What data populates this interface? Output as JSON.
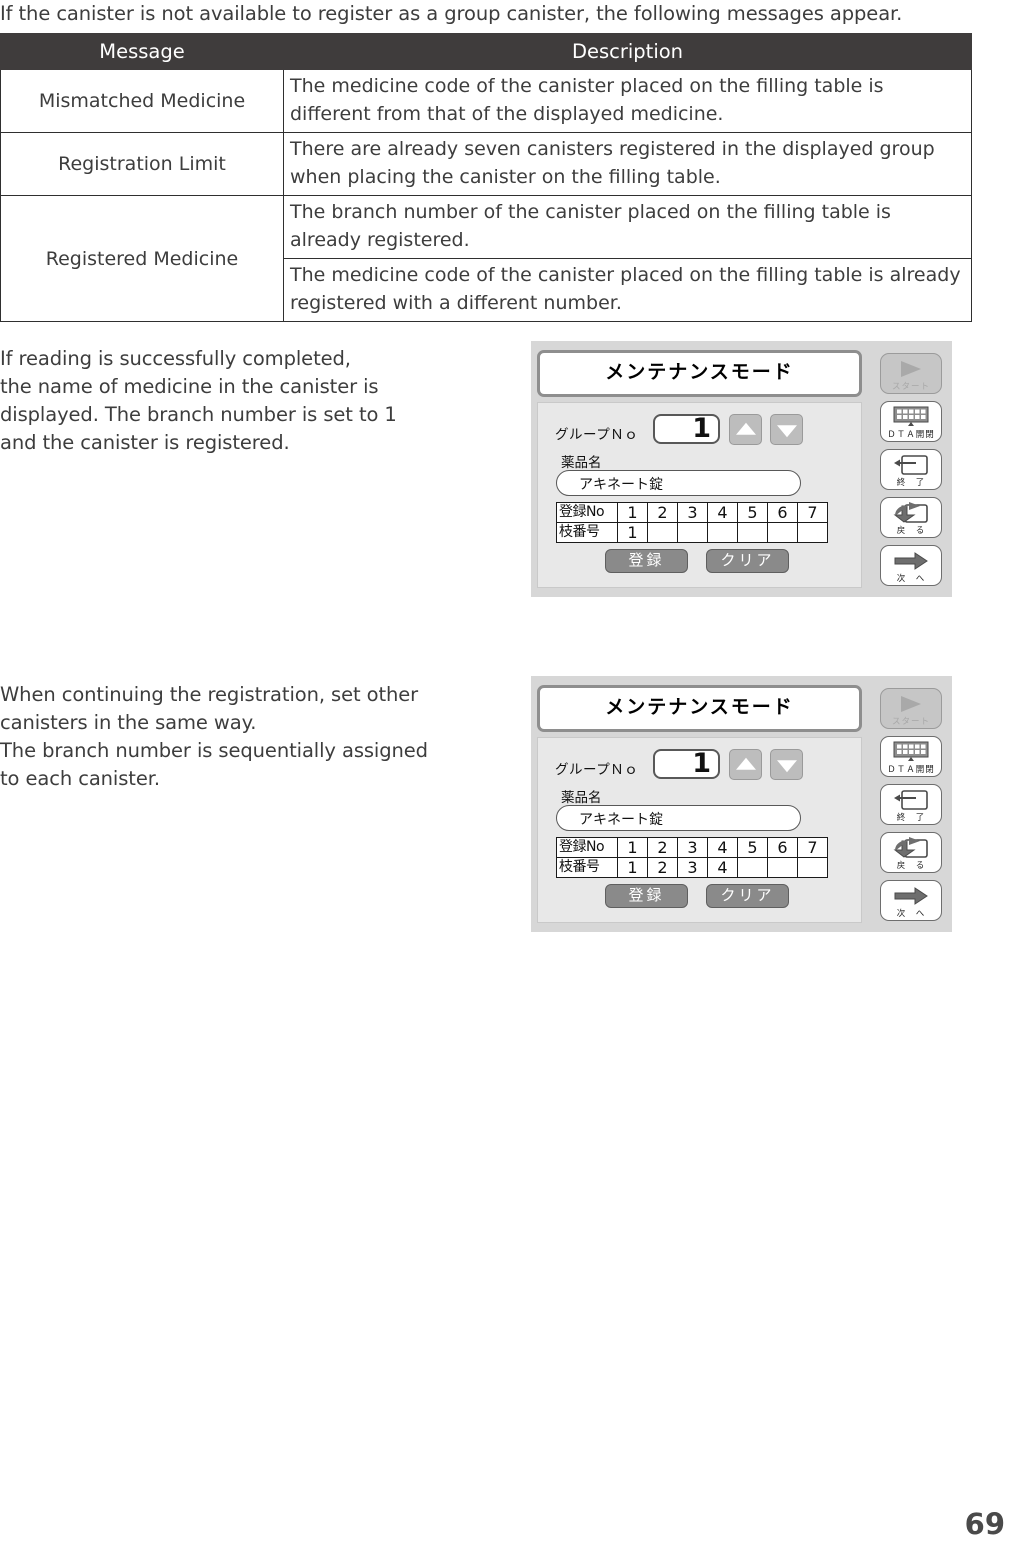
{
  "intro": {
    "text": "If the canister is not available to register as a group canister, the following messages appear."
  },
  "message_table": {
    "headers": [
      "Message",
      "Description"
    ],
    "rows": [
      {
        "message": "Mismatched Medicine",
        "descriptions": [
          "The medicine code of the canister placed on the filling table is different from that of the displayed medicine."
        ]
      },
      {
        "message": "Registration Limit",
        "descriptions": [
          "There are already seven canisters registered in the displayed group when placing the canister on the filling table."
        ]
      },
      {
        "message": "Registered Medicine",
        "descriptions": [
          "The branch number of the canister placed on the filling table is already registered.",
          "The medicine code of the canister placed on the filling table is already registered with a different number."
        ]
      }
    ]
  },
  "paragraphs": {
    "first": "If reading is successfully completed,\nthe name of medicine in the canister is\ndisplayed. The branch number is set to 1\nand the canister is registered.",
    "second": "When continuing the registration, set other\ncanisters in the same way.\nThe branch number is sequentially assigned\nto each canister."
  },
  "device_screens": [
    {
      "title": "メンテナンスモード",
      "group_label": "グループＮｏ",
      "group_value": "1",
      "medicine_label": "薬品名",
      "medicine_value": "アキネート錠",
      "reg_table": {
        "row1_head": "登録No",
        "row2_head": "枝番号",
        "row1_values": [
          "1",
          "2",
          "3",
          "4",
          "5",
          "6",
          "7"
        ],
        "row2_values": [
          "1",
          "",
          "",
          "",
          "",
          "",
          ""
        ]
      },
      "register_button": "登録",
      "clear_button": "クリア",
      "side_buttons": [
        {
          "label": "スタート",
          "icon": "play-icon",
          "disabled": true
        },
        {
          "label": "ＤＴＡ開閉",
          "icon": "dta-tray-icon",
          "disabled": false
        },
        {
          "label": "終　了",
          "icon": "exit-arrow-icon",
          "disabled": false
        },
        {
          "label": "戻　る",
          "icon": "back-arrow-icon",
          "disabled": false
        },
        {
          "label": "次　へ",
          "icon": "next-arrow-icon",
          "disabled": false
        }
      ]
    },
    {
      "title": "メンテナンスモード",
      "group_label": "グループＮｏ",
      "group_value": "1",
      "medicine_label": "薬品名",
      "medicine_value": "アキネート錠",
      "reg_table": {
        "row1_head": "登録No",
        "row2_head": "枝番号",
        "row1_values": [
          "1",
          "2",
          "3",
          "4",
          "5",
          "6",
          "7"
        ],
        "row2_values": [
          "1",
          "2",
          "3",
          "4",
          "",
          "",
          ""
        ]
      },
      "register_button": "登録",
      "clear_button": "クリア",
      "side_buttons": [
        {
          "label": "スタート",
          "icon": "play-icon",
          "disabled": true
        },
        {
          "label": "ＤＴＡ開閉",
          "icon": "dta-tray-icon",
          "disabled": false
        },
        {
          "label": "終　了",
          "icon": "exit-arrow-icon",
          "disabled": false
        },
        {
          "label": "戻　る",
          "icon": "back-arrow-icon",
          "disabled": false
        },
        {
          "label": "次　へ",
          "icon": "next-arrow-icon",
          "disabled": false
        }
      ]
    }
  ],
  "page_number": "69",
  "colors": {
    "table_header_bg": "#3f3c3c",
    "text": "#3d3d3d",
    "device_bezel": "#d7d7d7",
    "panel_bg": "#e8e8e8",
    "button_gray": "#8a8a8a"
  }
}
